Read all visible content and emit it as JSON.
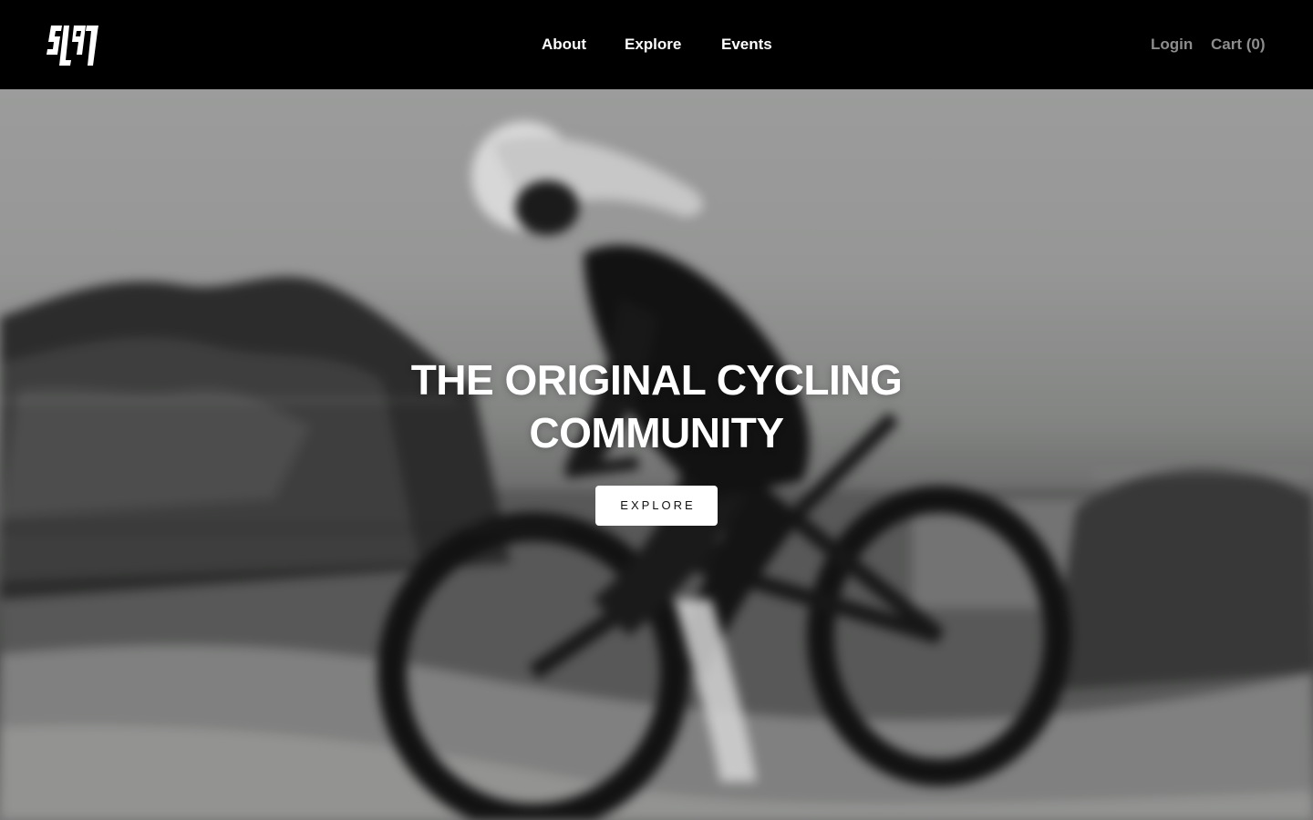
{
  "header": {
    "logo_text": "SL97",
    "nav": [
      {
        "label": "About"
      },
      {
        "label": "Explore"
      },
      {
        "label": "Events"
      }
    ],
    "login_label": "Login",
    "cart_label": "Cart (0)"
  },
  "hero": {
    "headline_line1": "THE ORIGINAL CYCLING",
    "headline_line2": "COMMUNITY",
    "cta_label": "EXPLORE",
    "image_description_icon": "cyclist-photo"
  },
  "colors": {
    "header_bg": "#000000",
    "nav_text": "#ffffff",
    "utility_text": "#8d8d8d",
    "cta_bg": "#ffffff",
    "cta_text": "#111111"
  }
}
